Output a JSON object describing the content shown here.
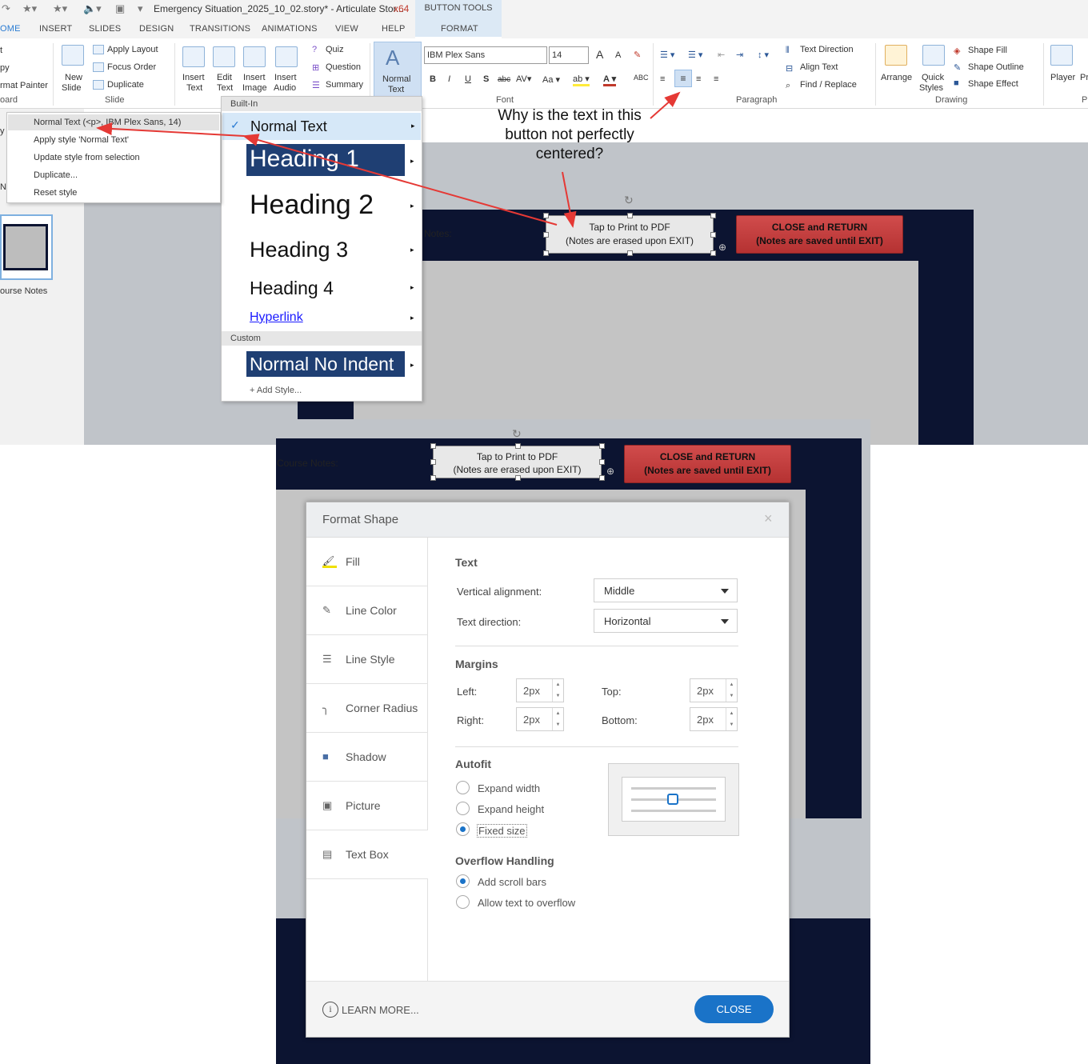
{
  "titlebar": {
    "title": "Emergency Situation_2025_10_02.story* - Articulate Stor...",
    "arch": "x64",
    "button_tools": "BUTTON TOOLS"
  },
  "tabs": [
    "OME",
    "INSERT",
    "SLIDES",
    "DESIGN",
    "TRANSITIONS",
    "ANIMATIONS",
    "VIEW",
    "HELP",
    "FORMAT"
  ],
  "ribbon": {
    "clipboard": {
      "cut": "t",
      "copy": "py",
      "format_painter": "rmat Painter",
      "group": "oard"
    },
    "slide": {
      "new_slide": "New",
      "new_slide2": "Slide",
      "apply_layout": "Apply Layout",
      "focus_order": "Focus Order",
      "duplicate": "Duplicate",
      "group": "Slide"
    },
    "insert": {
      "insert_text": "Insert",
      "insert_text2": "Text",
      "edit_text": "Edit",
      "edit_text2": "Text",
      "insert_image": "Insert",
      "insert_image2": "Image",
      "insert_audio": "Insert",
      "insert_audio2": "Audio",
      "quiz": "Quiz",
      "question": "Question",
      "summary": "Summary"
    },
    "normal_text": {
      "line1": "Normal",
      "line2": "Text"
    },
    "font": {
      "family": "IBM Plex Sans",
      "size": "14",
      "group": "Font",
      "grow": "A",
      "shrink": "A"
    },
    "paragraph": {
      "group": "Paragraph",
      "text_direction": "Text Direction",
      "align_text": "Align Text",
      "find_replace": "Find / Replace"
    },
    "drawing": {
      "arrange": "Arrange",
      "quick": "Quick",
      "styles": "Styles",
      "shape_fill": "Shape Fill",
      "shape_outline": "Shape Outline",
      "shape_effect": "Shape Effect",
      "group": "Drawing"
    },
    "player": {
      "player": "Player",
      "pr": "Pr",
      "p": "P"
    }
  },
  "slidepane": {
    "thumb_label": "ourse Notes",
    "side_y": "y",
    "side_n": "N"
  },
  "style_menu": {
    "builtin": "Built-In",
    "normal_text": "Normal Text",
    "heading1": "Heading 1",
    "heading2": "Heading 2",
    "heading3": "Heading 3",
    "heading4": "Heading 4",
    "hyperlink": "Hyperlink",
    "custom": "Custom",
    "normal_no_indent": "Normal No Indent",
    "add_style": "+ Add Style..."
  },
  "context_menu": {
    "items": [
      "Normal Text (<p>, IBM Plex Sans, 14)",
      "Apply style 'Normal Text'",
      "Update style from selection",
      "Duplicate...",
      "Reset style"
    ]
  },
  "annotation": "Why is the text in this button not perfectly centered?",
  "slide": {
    "notes_label": "Notes:",
    "course_notes": "Course Notes:",
    "btn_print_line1": "Tap to Print to PDF",
    "btn_print_line2": "(Notes are erased upon EXIT)",
    "btn_close_line1": "CLOSE and RETURN",
    "btn_close_line2": "(Notes are saved until EXIT)"
  },
  "dialog": {
    "title": "Format Shape",
    "close_x": "×",
    "nav": [
      "Fill",
      "Line Color",
      "Line Style",
      "Corner Radius",
      "Shadow",
      "Picture",
      "Text Box"
    ],
    "text_section": "Text",
    "vertical_alignment_label": "Vertical alignment:",
    "vertical_alignment_value": "Middle",
    "text_direction_label": "Text direction:",
    "text_direction_value": "Horizontal",
    "margins_section": "Margins",
    "left_label": "Left:",
    "left_value": "2px",
    "right_label": "Right:",
    "right_value": "2px",
    "top_label": "Top:",
    "top_value": "2px",
    "bottom_label": "Bottom:",
    "bottom_value": "2px",
    "autofit_section": "Autofit",
    "expand_width": "Expand width",
    "expand_height": "Expand height",
    "fixed_size": "Fixed size",
    "overflow_section": "Overflow Handling",
    "add_scroll_bars": "Add scroll bars",
    "allow_overflow": "Allow text to overflow",
    "learn_more": "LEARN MORE...",
    "close_button": "CLOSE"
  },
  "colors": {
    "accent": "#1a73c8",
    "navy": "#0c1431",
    "red_button": "#c03c3c",
    "annotation_arrow": "#e53935"
  }
}
